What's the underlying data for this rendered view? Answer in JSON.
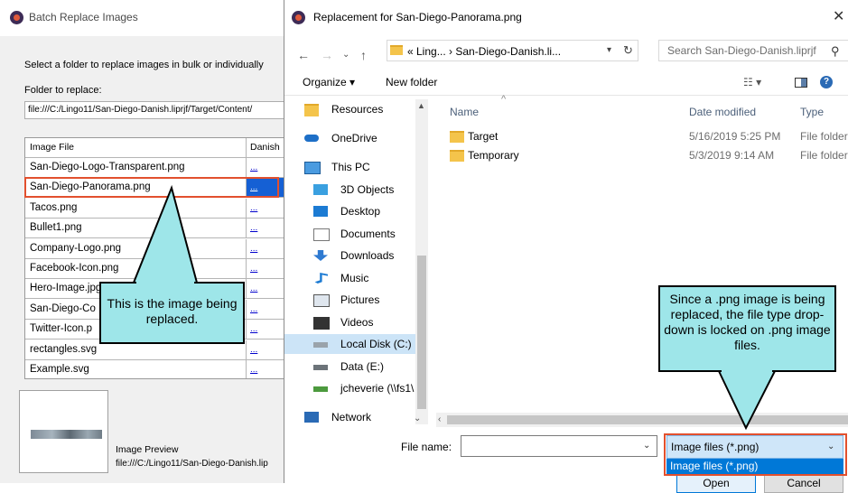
{
  "batch_window": {
    "title": "Batch Replace Images",
    "instruction": "Select a folder to replace images in bulk or individually",
    "folder_label": "Folder to replace:",
    "folder_path": "file:///C:/Lingo11/San-Diego-Danish.liprjf/Target/Content/",
    "grid_headers": [
      "Image File",
      "Danish"
    ],
    "rows": [
      {
        "file": "San-Diego-Logo-Transparent.png",
        "action": "..."
      },
      {
        "file": "San-Diego-Panorama.png",
        "action": "..."
      },
      {
        "file": "Tacos.png",
        "action": "..."
      },
      {
        "file": "Bullet1.png",
        "action": "..."
      },
      {
        "file": "Company-Logo.png",
        "action": "..."
      },
      {
        "file": "Facebook-Icon.png",
        "action": "..."
      },
      {
        "file": "Hero-Image.jpg",
        "action": "..."
      },
      {
        "file": "San-Diego-Co",
        "action": "..."
      },
      {
        "file": "Twitter-Icon.p",
        "action": "..."
      },
      {
        "file": "rectangles.svg",
        "action": "..."
      },
      {
        "file": "Example.svg",
        "action": "..."
      }
    ],
    "selected_row": 1,
    "preview_label": "Image Preview",
    "preview_path": "file:///C:/Lingo11/San-Diego-Danish.lip"
  },
  "dialog": {
    "title": "Replacement for San-Diego-Panorama.png",
    "address": "«  Ling...  ›  San-Diego-Danish.li...",
    "search_placeholder": "Search San-Diego-Danish.liprjf",
    "organize_label": "Organize ▾",
    "new_folder_label": "New folder",
    "nav_items": [
      {
        "label": "Resources",
        "icon": "folder-icon"
      },
      {
        "label": "OneDrive",
        "icon": "cloud-icon"
      },
      {
        "label": "This PC",
        "icon": "monitor-icon"
      },
      {
        "label": "3D Objects",
        "icon": "cube-icon"
      },
      {
        "label": "Desktop",
        "icon": "desktop-icon"
      },
      {
        "label": "Documents",
        "icon": "document-icon"
      },
      {
        "label": "Downloads",
        "icon": "download-icon"
      },
      {
        "label": "Music",
        "icon": "music-icon"
      },
      {
        "label": "Pictures",
        "icon": "pictures-icon"
      },
      {
        "label": "Videos",
        "icon": "video-icon"
      },
      {
        "label": "Local Disk (C:)",
        "icon": "disk-icon"
      },
      {
        "label": "Data (E:)",
        "icon": "drive-icon"
      },
      {
        "label": "jcheverie (\\\\fs1\\",
        "icon": "network-drive-icon"
      },
      {
        "label": "Network",
        "icon": "network-icon"
      }
    ],
    "selected_nav": 10,
    "columns": {
      "name": "Name",
      "date": "Date modified",
      "type": "Type"
    },
    "files": [
      {
        "name": "Target",
        "date": "5/16/2019 5:25 PM",
        "type": "File folder"
      },
      {
        "name": "Temporary",
        "date": "5/3/2019 9:14 AM",
        "type": "File folder"
      }
    ],
    "file_name_label": "File name:",
    "file_name_value": "",
    "file_type_value": "Image files (*.png)",
    "file_type_option": "Image files (*.png)",
    "open_label": "Open",
    "cancel_label": "Cancel"
  },
  "callouts": {
    "image_replaced": "This is the image being replaced.",
    "file_type_note": "Since a .png image is being replaced, the file type drop-down is locked on .png image files."
  },
  "colors": {
    "highlight": "#e2502e",
    "callout_fill": "#9ee6e9",
    "selection": "#0078d7"
  }
}
